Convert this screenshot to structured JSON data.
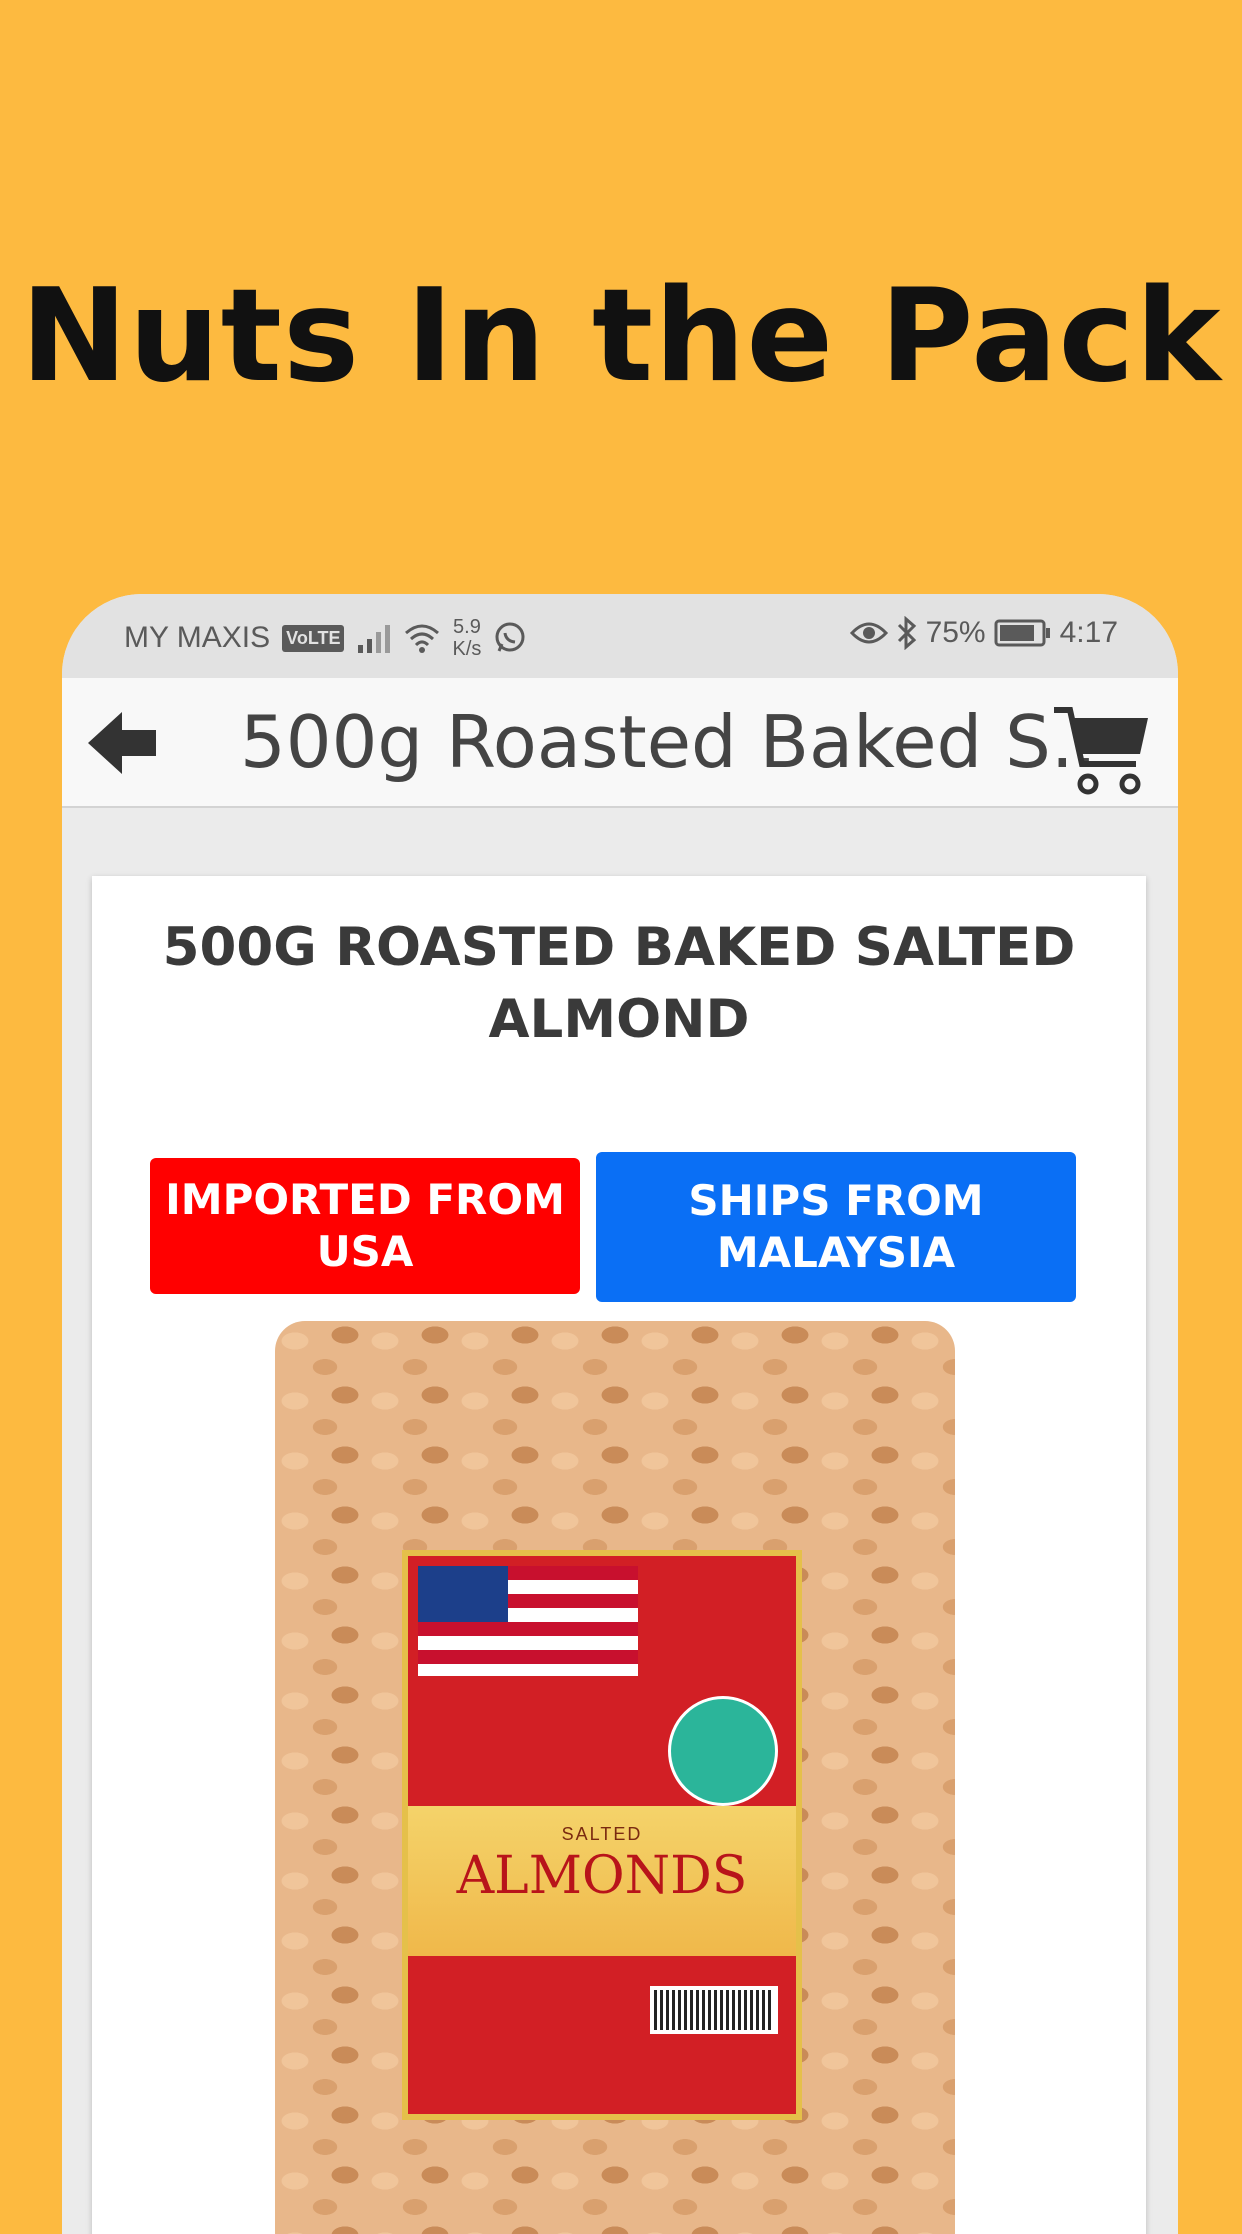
{
  "promo": {
    "headline": "Nuts In the Pack"
  },
  "status_bar": {
    "carrier": "MY MAXIS",
    "volte": "VoLTE",
    "speed_value": "5.9",
    "speed_unit": "K/s",
    "battery": "75%",
    "time": "4:17"
  },
  "app_bar": {
    "title": "500g Roasted Baked S..."
  },
  "product": {
    "title": "500G ROASTED BAKED SALTED ALMOND",
    "image": {
      "tag_left": "IMPORTED FROM USA",
      "tag_right": "SHIPS FROM MALAYSIA",
      "package_small": "SALTED",
      "package_brand": "ALMONDS"
    }
  },
  "colors": {
    "background": "#FDBA40",
    "status_bar": "#e2e2e2",
    "app_bar": "#f8f8f8",
    "tag_red": "#ff0000",
    "tag_blue": "#0a6ff5"
  },
  "icons": [
    "back-arrow-icon",
    "cart-icon",
    "signal-icon",
    "wifi-icon",
    "whatsapp-icon",
    "eye-icon",
    "bluetooth-icon",
    "battery-icon"
  ]
}
